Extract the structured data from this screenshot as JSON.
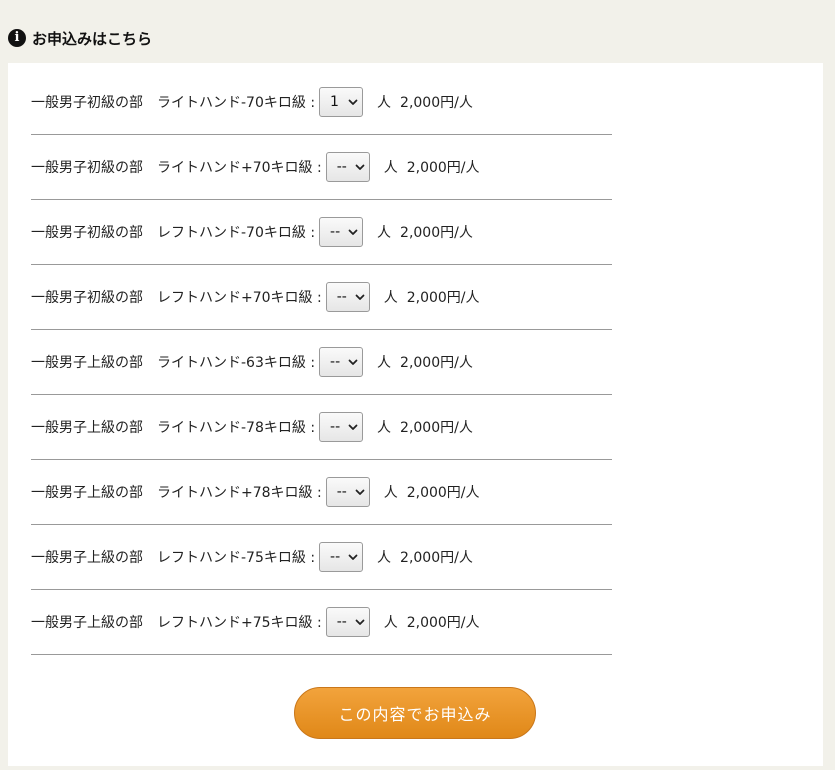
{
  "header": {
    "icon_glyph": "i",
    "title": "お申込みはこちら"
  },
  "entries": [
    {
      "category": "一般男子初級の部",
      "event": "ライトハンド-70キロ級 :",
      "selected": "1",
      "unit": "人",
      "price": "2,000円/人"
    },
    {
      "category": "一般男子初級の部",
      "event": "ライトハンド+70キロ級 :",
      "selected": "--",
      "unit": "人",
      "price": "2,000円/人"
    },
    {
      "category": "一般男子初級の部",
      "event": "レフトハンド-70キロ級 :",
      "selected": "--",
      "unit": "人",
      "price": "2,000円/人"
    },
    {
      "category": "一般男子初級の部",
      "event": "レフトハンド+70キロ級 :",
      "selected": "--",
      "unit": "人",
      "price": "2,000円/人"
    },
    {
      "category": "一般男子上級の部",
      "event": "ライトハンド-63キロ級 :",
      "selected": "--",
      "unit": "人",
      "price": "2,000円/人"
    },
    {
      "category": "一般男子上級の部",
      "event": "ライトハンド-78キロ級 :",
      "selected": "--",
      "unit": "人",
      "price": "2,000円/人"
    },
    {
      "category": "一般男子上級の部",
      "event": "ライトハンド+78キロ級 :",
      "selected": "--",
      "unit": "人",
      "price": "2,000円/人"
    },
    {
      "category": "一般男子上級の部",
      "event": "レフトハンド-75キロ級 :",
      "selected": "--",
      "unit": "人",
      "price": "2,000円/人"
    },
    {
      "category": "一般男子上級の部",
      "event": "レフトハンド+75キロ級 :",
      "selected": "--",
      "unit": "人",
      "price": "2,000円/人"
    }
  ],
  "submit": {
    "label": "この内容でお申込み"
  },
  "colors": {
    "background": "#f2f1ea",
    "panel": "#ffffff",
    "button_top": "#f2a33c",
    "button_bottom": "#e08818"
  }
}
